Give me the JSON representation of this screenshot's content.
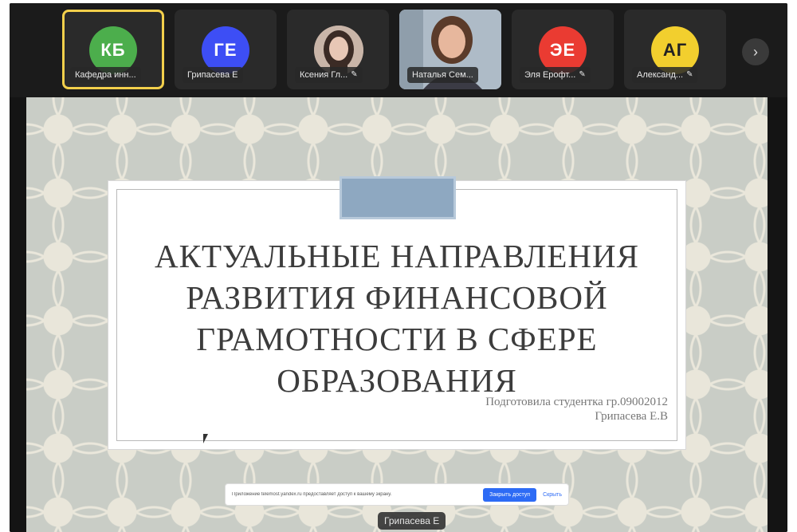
{
  "participants": [
    {
      "initials": "КБ",
      "name": "Кафедра инн...",
      "color": "#4cae4c",
      "active": true,
      "muted": false
    },
    {
      "initials": "ГЕ",
      "name": "Грипасева Е",
      "color": "#3d4ef5",
      "active": false,
      "muted": false
    },
    {
      "initials": "",
      "name": "Ксения Гл...",
      "color": "#8a7a74",
      "active": false,
      "muted": true,
      "photo": true
    },
    {
      "initials": "",
      "name": "Наталья Сем...",
      "color": "",
      "active": false,
      "muted": false,
      "video": true
    },
    {
      "initials": "ЭЕ",
      "name": "Эля Ерофт...",
      "color": "#ea3b32",
      "active": false,
      "muted": true
    },
    {
      "initials": "АГ",
      "name": "Александ...",
      "color": "#f2cf2e",
      "active": false,
      "muted": true
    }
  ],
  "icons": {
    "next": "chevron-right-icon",
    "mic_off": "mic-off-icon"
  },
  "slide": {
    "title_lines": [
      "АКТУАЛЬНЫЕ НАПРАВЛЕНИЯ",
      "РАЗВИТИЯ ФИНАНСОВОЙ",
      "ГРАМОТНОСТИ В СФЕРЕ",
      "ОБРАЗОВАНИЯ"
    ],
    "subtitle_line1": "Подготовила студентка гр.09002012",
    "subtitle_line2": "Грипасева Е.В"
  },
  "share_bar": {
    "text": "Приложение telemost.yandex.ru предоставляет доступ к вашему экрану.",
    "allow_label": "Закрыть доступ",
    "hide_label": "Скрыть"
  },
  "presenter": {
    "name": "Грипасева Е"
  }
}
